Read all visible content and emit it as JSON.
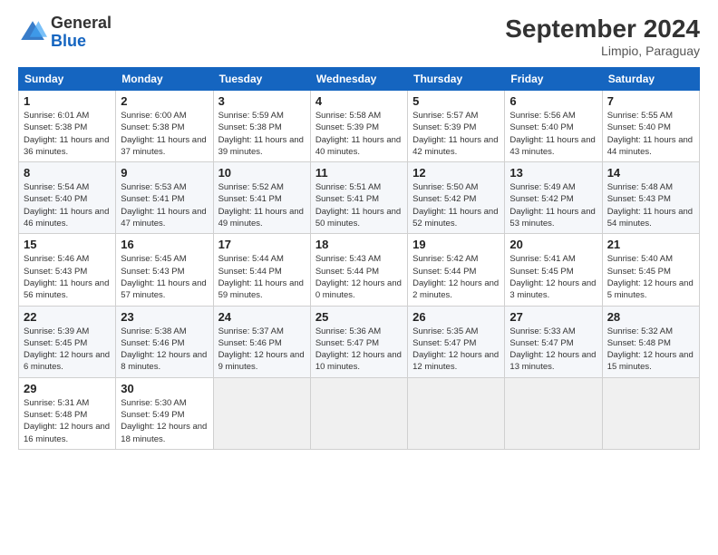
{
  "header": {
    "logo_general": "General",
    "logo_blue": "Blue",
    "month_title": "September 2024",
    "location": "Limpio, Paraguay"
  },
  "weekdays": [
    "Sunday",
    "Monday",
    "Tuesday",
    "Wednesday",
    "Thursday",
    "Friday",
    "Saturday"
  ],
  "weeks": [
    [
      {
        "day": 1,
        "sunrise": "6:01 AM",
        "sunset": "5:38 PM",
        "daylight": "11 hours and 36 minutes."
      },
      {
        "day": 2,
        "sunrise": "6:00 AM",
        "sunset": "5:38 PM",
        "daylight": "11 hours and 37 minutes."
      },
      {
        "day": 3,
        "sunrise": "5:59 AM",
        "sunset": "5:38 PM",
        "daylight": "11 hours and 39 minutes."
      },
      {
        "day": 4,
        "sunrise": "5:58 AM",
        "sunset": "5:39 PM",
        "daylight": "11 hours and 40 minutes."
      },
      {
        "day": 5,
        "sunrise": "5:57 AM",
        "sunset": "5:39 PM",
        "daylight": "11 hours and 42 minutes."
      },
      {
        "day": 6,
        "sunrise": "5:56 AM",
        "sunset": "5:40 PM",
        "daylight": "11 hours and 43 minutes."
      },
      {
        "day": 7,
        "sunrise": "5:55 AM",
        "sunset": "5:40 PM",
        "daylight": "11 hours and 44 minutes."
      }
    ],
    [
      {
        "day": 8,
        "sunrise": "5:54 AM",
        "sunset": "5:40 PM",
        "daylight": "11 hours and 46 minutes."
      },
      {
        "day": 9,
        "sunrise": "5:53 AM",
        "sunset": "5:41 PM",
        "daylight": "11 hours and 47 minutes."
      },
      {
        "day": 10,
        "sunrise": "5:52 AM",
        "sunset": "5:41 PM",
        "daylight": "11 hours and 49 minutes."
      },
      {
        "day": 11,
        "sunrise": "5:51 AM",
        "sunset": "5:41 PM",
        "daylight": "11 hours and 50 minutes."
      },
      {
        "day": 12,
        "sunrise": "5:50 AM",
        "sunset": "5:42 PM",
        "daylight": "11 hours and 52 minutes."
      },
      {
        "day": 13,
        "sunrise": "5:49 AM",
        "sunset": "5:42 PM",
        "daylight": "11 hours and 53 minutes."
      },
      {
        "day": 14,
        "sunrise": "5:48 AM",
        "sunset": "5:43 PM",
        "daylight": "11 hours and 54 minutes."
      }
    ],
    [
      {
        "day": 15,
        "sunrise": "5:46 AM",
        "sunset": "5:43 PM",
        "daylight": "11 hours and 56 minutes."
      },
      {
        "day": 16,
        "sunrise": "5:45 AM",
        "sunset": "5:43 PM",
        "daylight": "11 hours and 57 minutes."
      },
      {
        "day": 17,
        "sunrise": "5:44 AM",
        "sunset": "5:44 PM",
        "daylight": "11 hours and 59 minutes."
      },
      {
        "day": 18,
        "sunrise": "5:43 AM",
        "sunset": "5:44 PM",
        "daylight": "12 hours and 0 minutes."
      },
      {
        "day": 19,
        "sunrise": "5:42 AM",
        "sunset": "5:44 PM",
        "daylight": "12 hours and 2 minutes."
      },
      {
        "day": 20,
        "sunrise": "5:41 AM",
        "sunset": "5:45 PM",
        "daylight": "12 hours and 3 minutes."
      },
      {
        "day": 21,
        "sunrise": "5:40 AM",
        "sunset": "5:45 PM",
        "daylight": "12 hours and 5 minutes."
      }
    ],
    [
      {
        "day": 22,
        "sunrise": "5:39 AM",
        "sunset": "5:45 PM",
        "daylight": "12 hours and 6 minutes."
      },
      {
        "day": 23,
        "sunrise": "5:38 AM",
        "sunset": "5:46 PM",
        "daylight": "12 hours and 8 minutes."
      },
      {
        "day": 24,
        "sunrise": "5:37 AM",
        "sunset": "5:46 PM",
        "daylight": "12 hours and 9 minutes."
      },
      {
        "day": 25,
        "sunrise": "5:36 AM",
        "sunset": "5:47 PM",
        "daylight": "12 hours and 10 minutes."
      },
      {
        "day": 26,
        "sunrise": "5:35 AM",
        "sunset": "5:47 PM",
        "daylight": "12 hours and 12 minutes."
      },
      {
        "day": 27,
        "sunrise": "5:33 AM",
        "sunset": "5:47 PM",
        "daylight": "12 hours and 13 minutes."
      },
      {
        "day": 28,
        "sunrise": "5:32 AM",
        "sunset": "5:48 PM",
        "daylight": "12 hours and 15 minutes."
      }
    ],
    [
      {
        "day": 29,
        "sunrise": "5:31 AM",
        "sunset": "5:48 PM",
        "daylight": "12 hours and 16 minutes."
      },
      {
        "day": 30,
        "sunrise": "5:30 AM",
        "sunset": "5:49 PM",
        "daylight": "12 hours and 18 minutes."
      },
      null,
      null,
      null,
      null,
      null
    ]
  ]
}
